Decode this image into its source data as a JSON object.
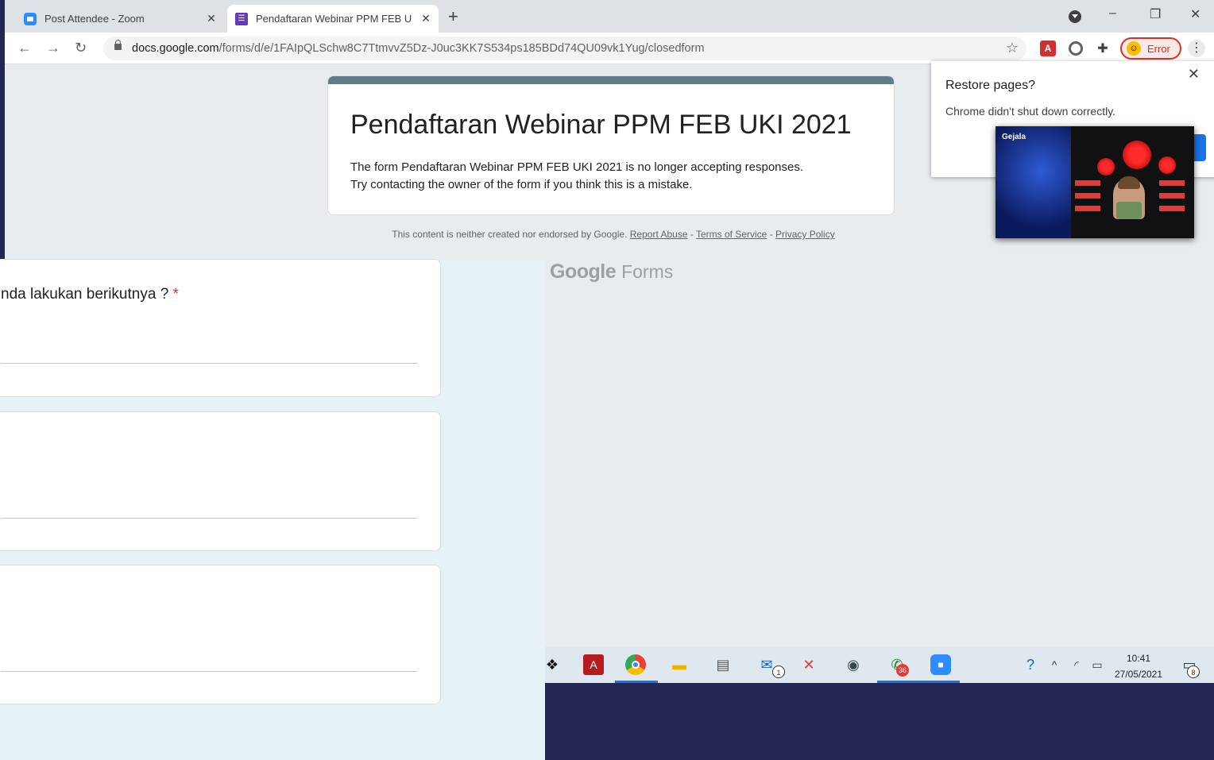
{
  "browser": {
    "tabs": [
      {
        "title": "Post Attendee - Zoom",
        "close": "✕"
      },
      {
        "title": "Pendaftaran Webinar PPM FEB U",
        "close": "✕"
      }
    ],
    "new_tab": "+",
    "window_controls": {
      "minimize": "–",
      "restore": "❐",
      "close": "✕"
    },
    "url_host": "docs.google.com",
    "url_path": "/forms/d/e/1FAIpQLSchw8C7TtmvvZ5Dz-J0uc3KK7S534ps185BDd74QU09vk1Yug/closedform",
    "profile_status": "Error"
  },
  "form": {
    "title": "Pendaftaran Webinar PPM FEB UKI 2021",
    "message_line1": "The form Pendaftaran Webinar PPM FEB UKI 2021 is no longer accepting responses.",
    "message_line2": "Try contacting the owner of the form if you think this is a mistake.",
    "disclaimer": "This content is neither created nor endorsed by Google.",
    "report_abuse": "Report Abuse",
    "terms": "Terms of Service",
    "privacy": "Privacy Policy",
    "sep": "-",
    "brand_google": "Google",
    "brand_forms": "Forms"
  },
  "restore_popup": {
    "title": "Restore pages?",
    "message": "Chrome didn't shut down correctly.",
    "close": "✕"
  },
  "thumbnail": {
    "label": "Gejala"
  },
  "background_form": {
    "question": "nda lakukan berikutnya ?",
    "required_mark": "*"
  },
  "taskbar": {
    "time": "10:41",
    "date": "27/05/2021",
    "mail_badge": "1",
    "whatsapp_badge": "36",
    "notification_badge": "8"
  },
  "colors": {
    "form_accent": "#607d8b",
    "required": "#d93025",
    "desktop": "#242653"
  }
}
